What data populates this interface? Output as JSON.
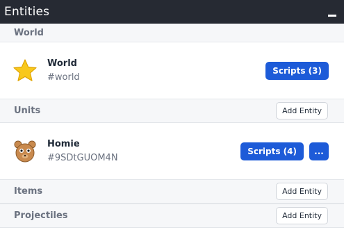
{
  "panel": {
    "title": "Entities"
  },
  "sections": {
    "world": {
      "label": "World",
      "entity": {
        "name": "World",
        "id": "#world",
        "icon": "star-icon",
        "scripts_label": "Scripts (3)"
      }
    },
    "units": {
      "label": "Units",
      "add_label": "Add Entity",
      "entity": {
        "name": "Homie",
        "id": "#9SDtGUOM4N",
        "icon": "bear-face-icon",
        "scripts_label": "Scripts (4)",
        "more_label": "..."
      }
    },
    "items": {
      "label": "Items",
      "add_label": "Add Entity"
    },
    "projectiles": {
      "label": "Projectiles",
      "add_label": "Add Entity"
    }
  },
  "colors": {
    "titlebar": "#262a33",
    "primary": "#1d5bd8",
    "section_bg": "#f6f7f9"
  }
}
